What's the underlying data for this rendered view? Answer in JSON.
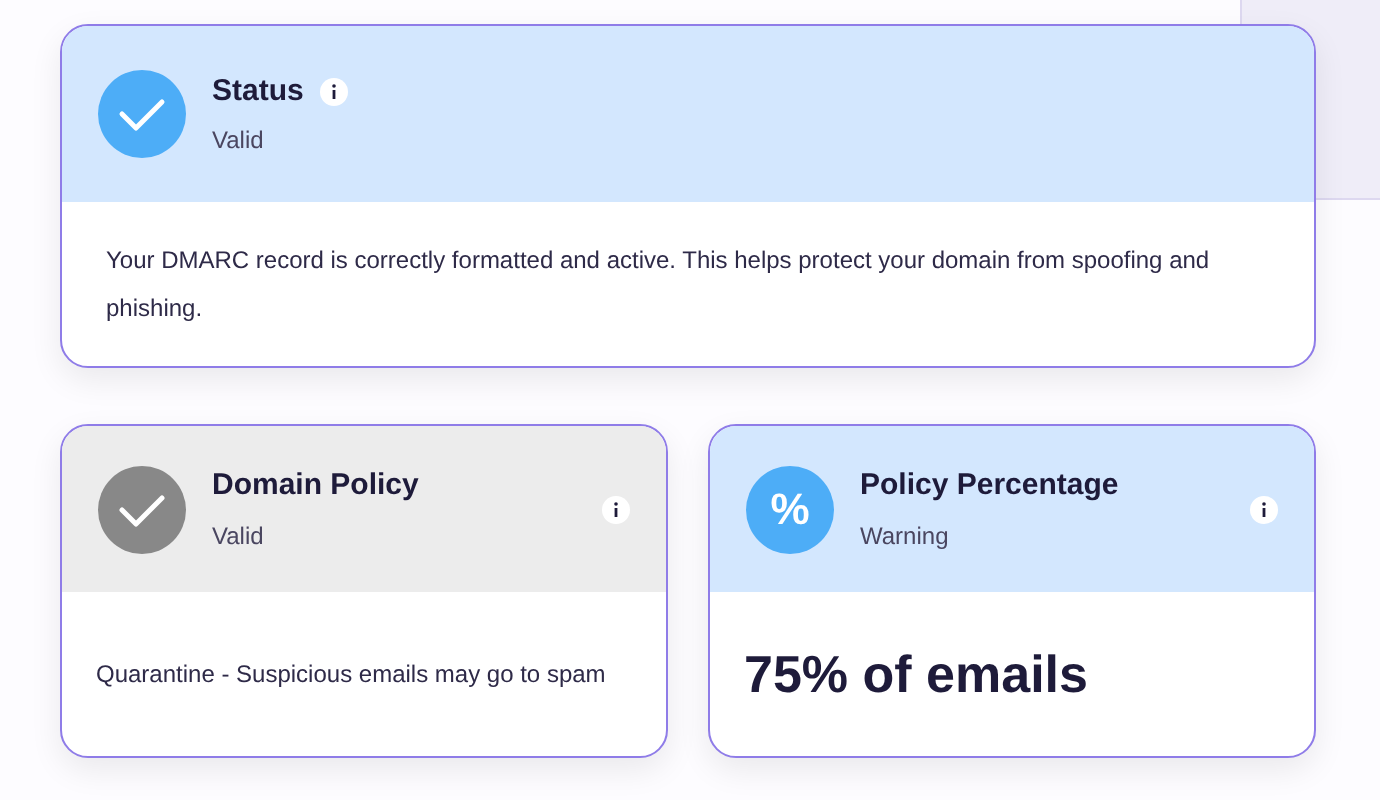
{
  "cards": [
    {
      "kind": "check",
      "title": "Status",
      "status": "Valid",
      "color": "#d3e7fe",
      "body": "Your DMARC record is correctly formatted and active. This helps protect your domain from spoofing and phishing."
    },
    {
      "kind": "check",
      "title": "Domain Policy",
      "status": "Valid",
      "color": "#ececec",
      "body": "Quarantine - Suspicious emails may go to spam"
    },
    {
      "kind": "percent",
      "title": "Policy Percentage",
      "status": "Warning",
      "color": "#d3e7fe",
      "icon_text": "%",
      "body": "75% of emails"
    }
  ]
}
